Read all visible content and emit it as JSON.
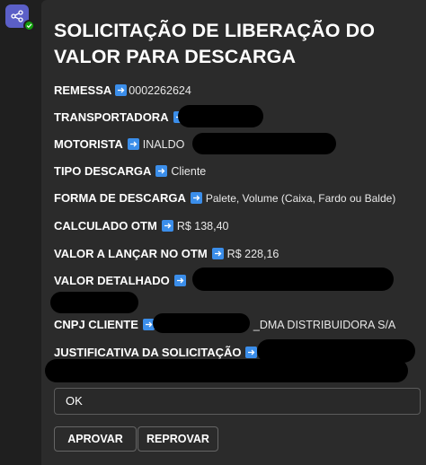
{
  "card": {
    "title": "SOLICITAÇÃO DE LIBERAÇÃO DO VALOR PARA DESCARGA",
    "fields": {
      "remessa": {
        "label": "REMESSA",
        "value": "0002262624"
      },
      "transportadora": {
        "label": "TRANSPORTADORA",
        "value": ""
      },
      "motorista": {
        "label": "MOTORISTA",
        "value": "INALDO"
      },
      "tipo_descarga": {
        "label": "TIPO DESCARGA",
        "value": "Cliente"
      },
      "forma_descarga": {
        "label": "FORMA DE DESCARGA",
        "value": "Palete, Volume (Caixa, Fardo ou Balde)"
      },
      "calculado_otm": {
        "label": "CALCULADO OTM",
        "value": "R$ 138,40"
      },
      "valor_lancar": {
        "label": "VALOR A LANÇAR NO OTM",
        "value": "R$ 228,16"
      },
      "valor_detalhado": {
        "label": "VALOR DETALHADO",
        "value": ""
      },
      "cnpj_cliente": {
        "label": "CNPJ CLIENTE",
        "value": "_DMA DISTRIBUIDORA S/A"
      },
      "justificativa": {
        "label": "JUSTIFICATIVA DA SOLICITAÇÃO",
        "value": ""
      }
    },
    "input": {
      "value": "OK"
    },
    "buttons": {
      "approve": "APROVAR",
      "reject": "REPROVAR"
    }
  },
  "icons": {
    "bot_avatar": "share-nodes-icon",
    "field_arrow": "arrow-right-icon"
  },
  "colors": {
    "accent": "#5b5fc7",
    "arrow": "#3b8eea",
    "status": "#13a10e"
  }
}
